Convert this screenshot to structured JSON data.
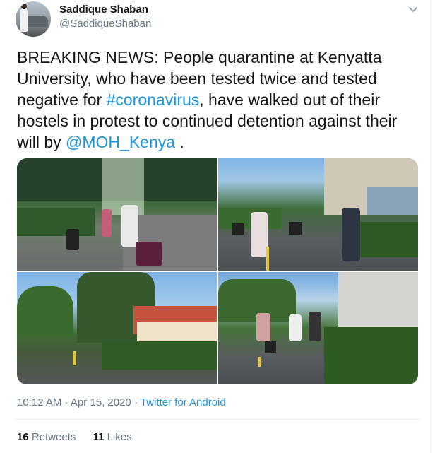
{
  "user": {
    "name": "Saddique Shaban",
    "handle": "@SaddiqueShaban"
  },
  "tweet": {
    "text_part1": "BREAKING NEWS: People quarantine at Kenyatta University, who have been tested twice and tested negative for ",
    "hashtag": "#coronavirus",
    "text_part2": ", have walked out of their hostels in protest to continued detention against their will by ",
    "mention": "@MOH_Kenya",
    "text_part3": " ."
  },
  "meta": {
    "timestamp": "10:12 AM · Apr 15, 2020 · ",
    "source": "Twitter for Android"
  },
  "stats": {
    "retweets_count": "16",
    "retweets_label": " Retweets",
    "likes_count": "11",
    "likes_label": " Likes"
  },
  "colors": {
    "link": "#1b95e0",
    "secondary": "#657786",
    "text": "#14171a"
  },
  "icons": {
    "menu": "chevron-down-icon"
  }
}
